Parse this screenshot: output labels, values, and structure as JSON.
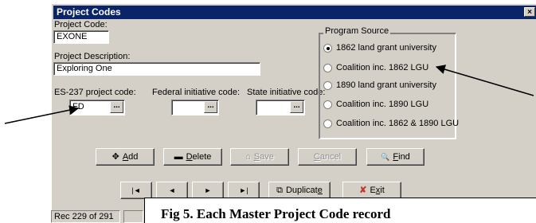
{
  "window": {
    "title": "Project Codes",
    "close_glyph": "×"
  },
  "fields": {
    "project_code": {
      "label": "Project Code:",
      "value": "EXONE"
    },
    "project_description": {
      "label": "Project Description:",
      "value": "Exploring One"
    },
    "es237": {
      "label": "ES-237 project code:",
      "value": "FD"
    },
    "federal": {
      "label": "Federal initiative code:",
      "value": ""
    },
    "state": {
      "label": "State initiative code:",
      "value": ""
    },
    "lookup_glyph": "..."
  },
  "program_source": {
    "title": "Program Source",
    "options": [
      {
        "label": "1862 land grant university",
        "selected": true
      },
      {
        "label": "Coalition inc. 1862 LGU",
        "selected": false
      },
      {
        "label": "1890 land grant university",
        "selected": false
      },
      {
        "label": "Coalition inc. 1890 LGU",
        "selected": false
      },
      {
        "label": "Coalition inc. 1862 & 1890 LGU",
        "selected": false
      }
    ]
  },
  "actions": {
    "add": {
      "icon": "plus-icon",
      "glyph": "✥",
      "u": "A",
      "rest": "dd"
    },
    "delete": {
      "icon": "minus-icon",
      "glyph": "▬",
      "u": "D",
      "rest": "elete"
    },
    "save": {
      "icon": "save-icon",
      "glyph": "⌂",
      "u": "S",
      "rest": "ave"
    },
    "cancel": {
      "u": "C",
      "rest": "ancel"
    },
    "find": {
      "icon": "find-icon",
      "glyph": "🔍",
      "u": "F",
      "rest": "ind"
    }
  },
  "navigation": {
    "first": "|◄",
    "prev": "◄",
    "next": "►",
    "last": "►|",
    "duplicate": {
      "icon": "duplicate-icon",
      "glyph": "⧉",
      "pre": "Duplicat",
      "u": "e"
    },
    "exit": {
      "icon": "exit-x-icon",
      "glyph": "✘",
      "pre": "E",
      "u": "x",
      "rest": "it"
    }
  },
  "status": {
    "record": "Rec 229 of 291"
  },
  "caption": "Fig 5.  Each Master Project Code record"
}
